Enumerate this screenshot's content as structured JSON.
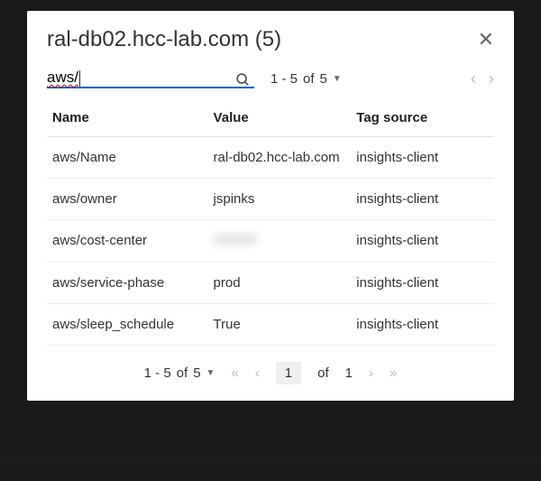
{
  "header": {
    "title": "ral-db02.hcc-lab.com (5)"
  },
  "search": {
    "value": "aws/"
  },
  "pagination_top": {
    "range": "1 - 5",
    "of_label": "of",
    "total": "5"
  },
  "columns": {
    "name": "Name",
    "value": "Value",
    "source": "Tag source"
  },
  "rows": [
    {
      "name": "aws/Name",
      "value": "ral-db02.hcc-lab.com",
      "source": "insights-client",
      "redacted": false
    },
    {
      "name": "aws/owner",
      "value": "jspinks",
      "source": "insights-client",
      "redacted": false
    },
    {
      "name": "aws/cost-center",
      "value": "",
      "source": "insights-client",
      "redacted": true
    },
    {
      "name": "aws/service-phase",
      "value": "prod",
      "source": "insights-client",
      "redacted": false
    },
    {
      "name": "aws/sleep_schedule",
      "value": "True",
      "source": "insights-client",
      "redacted": false
    }
  ],
  "pagination_bottom": {
    "range": "1 - 5",
    "of_label": "of",
    "total": "5",
    "page": "1",
    "page_of_label": "of",
    "page_total": "1"
  }
}
